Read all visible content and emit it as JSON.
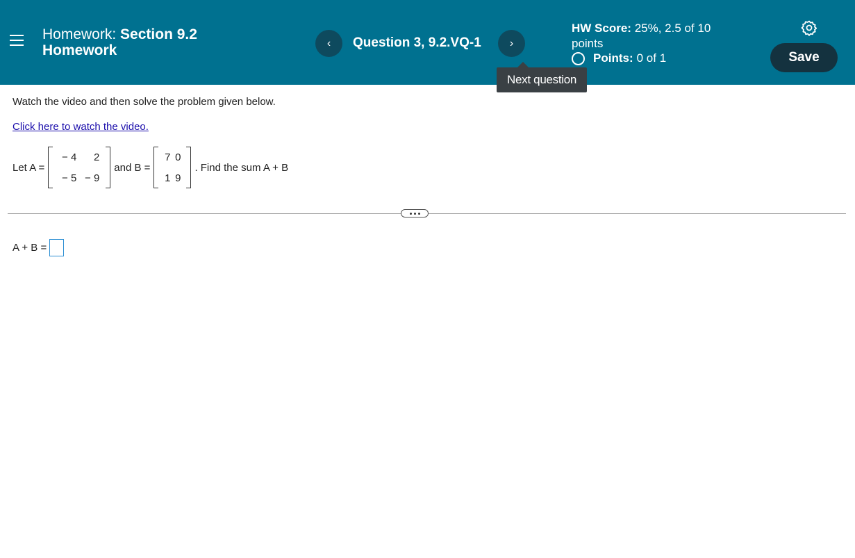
{
  "header": {
    "title_prefix": "Homework:",
    "title_bold_1": "Section 9.2",
    "title_bold_2": "Homework",
    "question_label": "Question 3, 9.2.VQ-1",
    "prev_glyph": "‹",
    "next_glyph": "›",
    "tooltip": "Next question",
    "score_label": "HW Score:",
    "score_value": "25%, 2.5 of 10",
    "score_suffix": "points",
    "points_label": "Points:",
    "points_value": "0 of 1",
    "save_label": "Save",
    "menu_icon": "hamburger-menu-icon",
    "settings_icon": "gear-icon",
    "status_icon": "empty-circle-icon"
  },
  "content": {
    "instructions": "Watch the video and then solve the problem given below.",
    "video_link": "Click here to watch the video.",
    "let_a": "Let A =",
    "and_b": "and B =",
    "find_sum": ". Find the sum A + B",
    "matrix_a": [
      [
        "− 4",
        "2"
      ],
      [
        "− 5",
        "− 9"
      ]
    ],
    "matrix_b": [
      [
        "7",
        "0"
      ],
      [
        "1",
        "9"
      ]
    ],
    "answer_label": "A + B ="
  },
  "colors": {
    "header_bg": "#007190",
    "nav_button_bg": "#0e4a5e",
    "save_button_bg": "#14323f",
    "tooltip_bg": "#3a4044",
    "link": "#1a0dab",
    "answer_box_border": "#2b8ed3"
  }
}
